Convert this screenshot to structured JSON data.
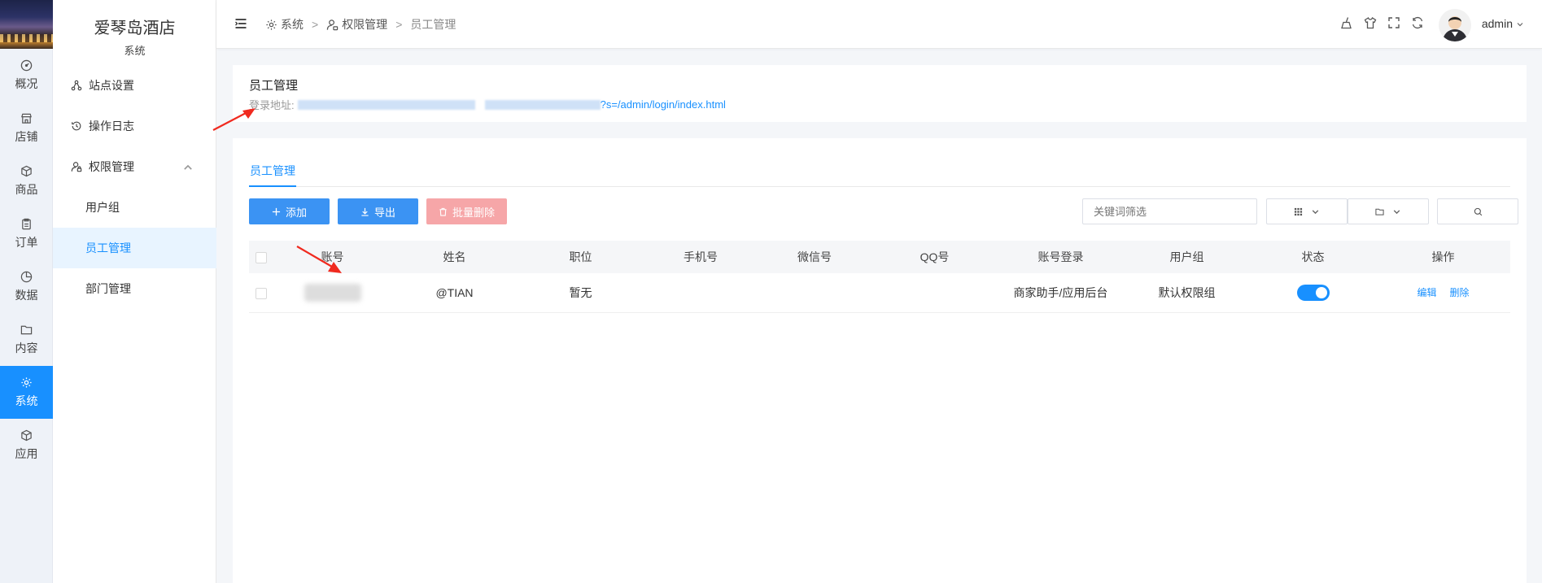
{
  "rail": {
    "items": [
      {
        "label": "概况",
        "icon": "dashboard-icon"
      },
      {
        "label": "店铺",
        "icon": "shop-icon"
      },
      {
        "label": "商品",
        "icon": "box-icon"
      },
      {
        "label": "订单",
        "icon": "clipboard-icon"
      },
      {
        "label": "数据",
        "icon": "pie-icon"
      },
      {
        "label": "内容",
        "icon": "folder-icon"
      },
      {
        "label": "系统",
        "icon": "gear-icon",
        "active": true
      },
      {
        "label": "应用",
        "icon": "cube-icon"
      }
    ]
  },
  "submenu": {
    "brand": "爱琴岛酒店",
    "section": "系统",
    "items": [
      {
        "label": "站点设置",
        "icon": "sitemap-icon"
      },
      {
        "label": "操作日志",
        "icon": "history-icon"
      },
      {
        "label": "权限管理",
        "icon": "user-lock-icon",
        "expanded": true
      },
      {
        "label": "用户组",
        "child": true
      },
      {
        "label": "员工管理",
        "child": true,
        "active": true
      },
      {
        "label": "部门管理",
        "child": true
      }
    ]
  },
  "header": {
    "breadcrumb": [
      "系统",
      "权限管理",
      "员工管理"
    ],
    "separator": ">",
    "user": "admin"
  },
  "info_card": {
    "title": "员工管理",
    "login_label": "登录地址:",
    "login_url_suffix": "?s=/admin/login/index.html"
  },
  "main": {
    "tab": "员工管理",
    "buttons": {
      "add": "添加",
      "export": "导出",
      "batch_delete": "批量删除"
    },
    "search_placeholder": "关键词筛选",
    "columns": [
      "账号",
      "姓名",
      "职位",
      "手机号",
      "微信号",
      "QQ号",
      "账号登录",
      "用户组",
      "状态",
      "操作"
    ],
    "rows": [
      {
        "account": "",
        "name": "@TIAN",
        "position": "暂无",
        "phone": "",
        "wechat": "",
        "qq": "",
        "login": "商家助手/应用后台",
        "group": "默认权限组",
        "status_on": true,
        "edit": "编辑",
        "delete": "删除"
      }
    ]
  },
  "colors": {
    "accent": "#1890ff",
    "danger_disabled": "#f6a6a8",
    "annotation": "#f02a1f"
  }
}
